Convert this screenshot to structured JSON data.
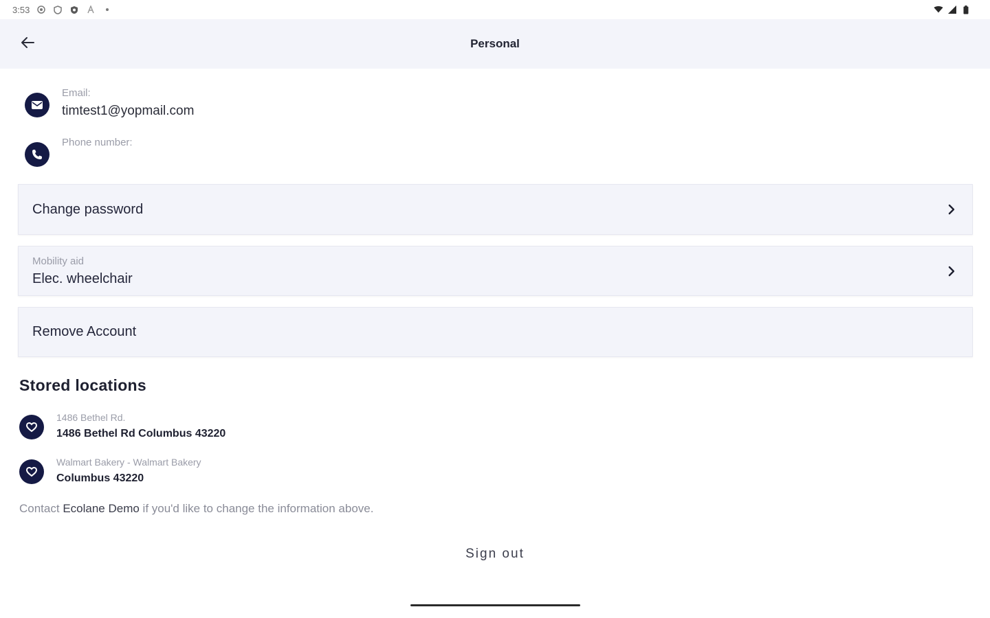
{
  "status_bar": {
    "time": "3:53",
    "icons_left": [
      "settings-icon",
      "shield-icon",
      "shield-filled-icon",
      "a-icon",
      "dot-icon"
    ],
    "icons_right": [
      "wifi-icon",
      "signal-icon",
      "battery-icon"
    ]
  },
  "app_bar": {
    "title": "Personal",
    "back_icon": "arrow-left-icon"
  },
  "contact": {
    "email_label": "Email:",
    "email_value": "timtest1@yopmail.com",
    "phone_label": "Phone number:",
    "phone_value": ""
  },
  "cards": {
    "change_password": "Change password",
    "mobility_aid_label": "Mobility aid",
    "mobility_aid_value": "Elec. wheelchair",
    "remove_account": "Remove Account"
  },
  "stored_locations": {
    "title": "Stored locations",
    "items": [
      {
        "label": "1486 Bethel Rd.",
        "value": "1486 Bethel Rd Columbus 43220"
      },
      {
        "label": "Walmart Bakery - Walmart Bakery",
        "value": "Columbus 43220"
      }
    ]
  },
  "note": {
    "prefix": "Contact ",
    "org": "Ecolane Demo",
    "suffix": " if you'd like to change the information above."
  },
  "sign_out_label": "Sign out",
  "colors": {
    "app_bar_bg": "#f3f4fa",
    "icon_navy": "#151a45",
    "card_bg": "#f3f4fa"
  }
}
